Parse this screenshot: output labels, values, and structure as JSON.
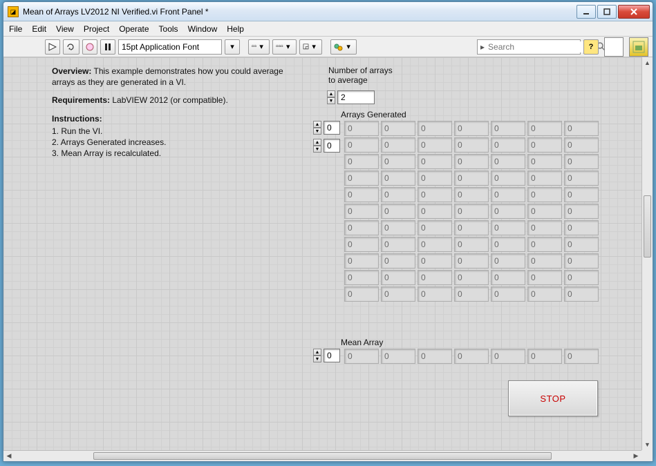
{
  "window": {
    "title": "Mean of Arrays LV2012 NI Verified.vi Front Panel *"
  },
  "menu": [
    "File",
    "Edit",
    "View",
    "Project",
    "Operate",
    "Tools",
    "Window",
    "Help"
  ],
  "toolbar": {
    "font": "15pt Application Font",
    "search_placeholder": "Search"
  },
  "doc": {
    "overview_label": "Overview:",
    "overview_text": "This example demonstrates how you could average arrays as they are generated in a VI.",
    "req_label": "Requirements:",
    "req_text": "LabVIEW 2012 (or compatible).",
    "instr_label": "Instructions:",
    "instr": [
      "1. Run the VI.",
      "2. Arrays Generated increases.",
      "3. Mean Array is recalculated."
    ]
  },
  "controls": {
    "num_arrays_label": "Number of arrays\nto average",
    "num_arrays_value": "2",
    "arrays_gen_label": "Arrays Generated",
    "arrays_gen_row_index": "0",
    "arrays_gen_col_index": "0",
    "arrays_gen_rows": 11,
    "arrays_gen_cols": 7,
    "arrays_gen_cell": "0",
    "mean_label": "Mean Array",
    "mean_index": "0",
    "mean_cols": 7,
    "mean_cell": "0",
    "stop_label": "STOP"
  }
}
